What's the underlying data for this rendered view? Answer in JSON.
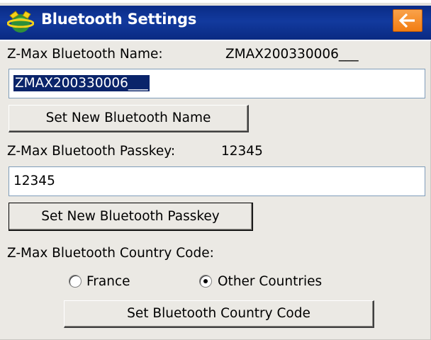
{
  "window": {
    "title": "Bluetooth Settings",
    "back_icon": "left-arrow-icon",
    "app_icon": "satellite-globe-icon",
    "accent_colors": {
      "titlebar": "#123a9e",
      "back_button": "#f27d12"
    }
  },
  "name_section": {
    "label": "Z-Max Bluetooth Name:",
    "current_value": "ZMAX200330006___",
    "input_value": "ZMAX200330006___",
    "button_label": "Set New Bluetooth Name"
  },
  "passkey_section": {
    "label": "Z-Max Bluetooth Passkey:",
    "current_value": "12345",
    "input_value": "12345",
    "button_label": "Set New Bluetooth Passkey"
  },
  "country_section": {
    "label": "Z-Max Bluetooth Country Code:",
    "options": [
      {
        "label": "France",
        "selected": false
      },
      {
        "label": "Other Countries",
        "selected": true
      }
    ],
    "button_label": "Set Bluetooth Country Code"
  }
}
